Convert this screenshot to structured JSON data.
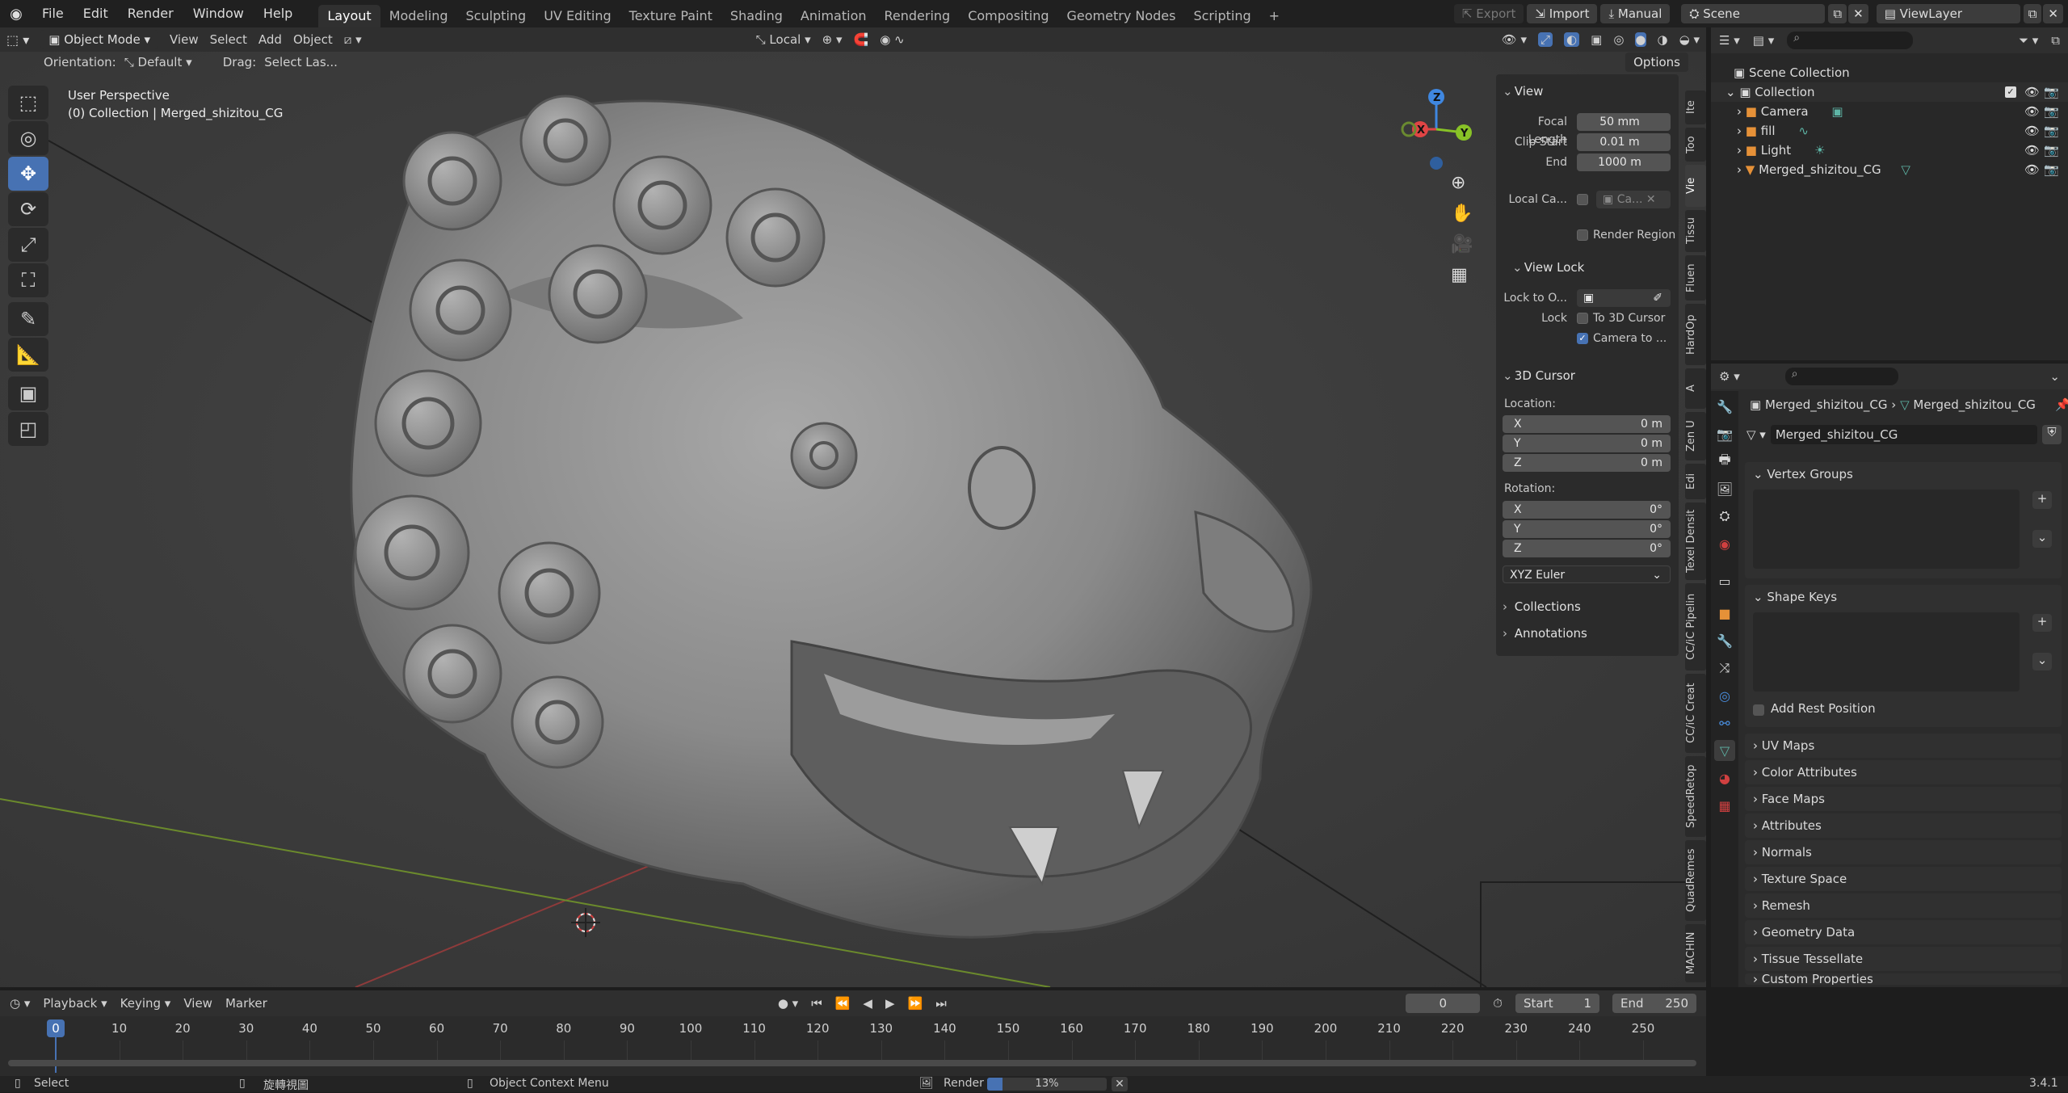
{
  "topbar": {
    "menus": [
      "File",
      "Edit",
      "Render",
      "Window",
      "Help"
    ],
    "workspaces": [
      "Layout",
      "Modeling",
      "Sculpting",
      "UV Editing",
      "Texture Paint",
      "Shading",
      "Animation",
      "Rendering",
      "Compositing",
      "Geometry Nodes",
      "Scripting"
    ],
    "active_workspace": "Layout",
    "add_tab": "+",
    "export_label": "Export",
    "import_label": "Import",
    "manual_label": "Manual",
    "scene_label": "Scene",
    "viewlayer_label": "ViewLayer"
  },
  "viewport_header": {
    "mode": "Object Mode",
    "menus": [
      "View",
      "Select",
      "Add",
      "Object"
    ],
    "transform_orientation": "Local",
    "orientation_label": "Orientation:",
    "orientation_value": "Default",
    "drag_label": "Drag:",
    "drag_value": "Select Las...",
    "options_label": "Options"
  },
  "viewport": {
    "view_name": "User Perspective",
    "collection_info": "(0) Collection | Merged_shizitou_CG",
    "gizmo_axes": {
      "x": "X",
      "y": "Y",
      "z": "Z"
    },
    "axis_colors": {
      "x": "#e04545",
      "y": "#88c227",
      "z": "#3f87e0"
    }
  },
  "npanel": {
    "view_header": "View",
    "focal_length_label": "Focal Length",
    "focal_length": "50 mm",
    "clip_start_label": "Clip Start",
    "clip_start": "0.01 m",
    "clip_end_label": "End",
    "clip_end": "1000 m",
    "local_camera_label": "Local Ca...",
    "local_camera_value": "Ca...",
    "render_region_label": "Render Region",
    "view_lock_header": "View Lock",
    "lock_to_object_label": "Lock to O...",
    "lock_label": "Lock",
    "to_3d_cursor_label": "To 3D Cursor",
    "camera_to_label": "Camera to ...",
    "cursor_header": "3D Cursor",
    "location_label": "Location:",
    "loc_x": "0 m",
    "loc_y": "0 m",
    "loc_z": "0 m",
    "rotation_label": "Rotation:",
    "rot_x": "0°",
    "rot_y": "0°",
    "rot_z": "0°",
    "axis_x": "X",
    "axis_y": "Y",
    "axis_z": "Z",
    "rotation_mode": "XYZ Euler",
    "collections_label": "Collections",
    "annotations_label": "Annotations"
  },
  "sidebar_tabs": [
    "Ite",
    "Too",
    "Vie",
    "Tissu",
    "Fluen",
    "HardOp",
    "A",
    "Zen U",
    "Edi",
    "Texel Densit",
    "CC/iC Pipelin",
    "CC/iC Creat",
    "SpeedRetop",
    "QuadRemes",
    "MACHIN"
  ],
  "outliner": {
    "scene_collection": "Scene Collection",
    "collection": "Collection",
    "items": [
      "Camera",
      "fill",
      "Light",
      "Merged_shizitou_CG"
    ]
  },
  "properties": {
    "breadcrumb_object": "Merged_shizitou_CG",
    "breadcrumb_mesh": "Merged_shizitou_CG",
    "mesh_name": "Merged_shizitou_CG",
    "vertex_groups": "Vertex Groups",
    "shape_keys": "Shape Keys",
    "add_rest_position": "Add Rest Position",
    "collapsed_panels": [
      "UV Maps",
      "Color Attributes",
      "Face Maps",
      "Attributes",
      "Normals",
      "Texture Space",
      "Remesh",
      "Geometry Data",
      "Tissue Tessellate",
      "Custom Properties"
    ]
  },
  "timeline": {
    "menus": [
      "Playback",
      "Keying",
      "View",
      "Marker"
    ],
    "current_frame": "0",
    "start_label": "Start",
    "start": "1",
    "end_label": "End",
    "end": "250",
    "ticks": [
      "0",
      "10",
      "20",
      "30",
      "40",
      "50",
      "60",
      "70",
      "80",
      "90",
      "100",
      "110",
      "120",
      "130",
      "140",
      "150",
      "160",
      "170",
      "180",
      "190",
      "200",
      "210",
      "220",
      "230",
      "240",
      "250"
    ]
  },
  "statusbar": {
    "select": "Select",
    "rotate_view": "旋轉視圖",
    "context_menu": "Object Context Menu",
    "render_label": "Render",
    "render_progress": 0.13,
    "render_progress_text": "13%",
    "version": "3.4.1"
  }
}
